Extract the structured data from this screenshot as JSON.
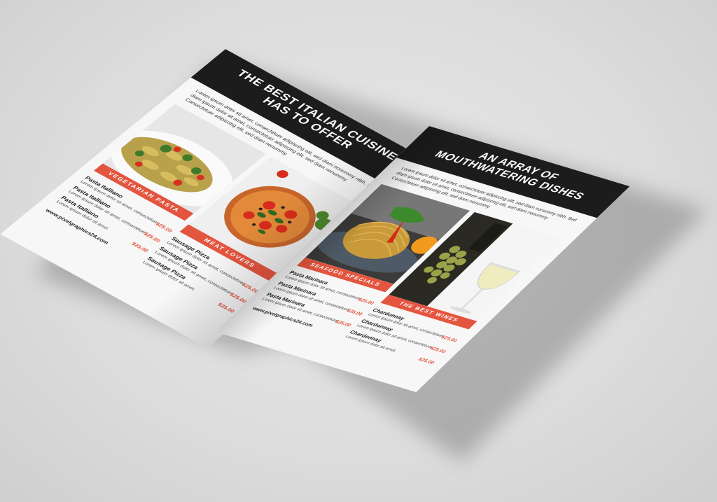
{
  "colors": {
    "accent": "#e4553f",
    "band": "#1c1c1c",
    "paper": "#f7f7f7",
    "background": "#dcdcdc"
  },
  "left_page": {
    "title_line1": "THE BEST ITALIAN CUISINE",
    "title_line2": "HAS TO OFFER",
    "intro": "Lorem ipsum dolor sit amet, consectetuer adipiscing elit, sed diam nonummy nibh. Sed diam ipsum dolor sit amet, consectetuer adipiscing elit, sed diam nonummy. Consectetuer adipiscing elit, sed diam nonummy.",
    "sections": [
      {
        "tag": "VEGETARIAN PASTA",
        "photo": "farfalle-pasta-salad",
        "items": [
          {
            "name": "Pasta Italliano",
            "desc": "Lorem ipsum dolor sit amet, consectetuer.",
            "price": "$25.00"
          },
          {
            "name": "Pasta Italliano",
            "desc": "Lorem ipsum dolor sit amet, consectetuer.",
            "price": "$25.00"
          },
          {
            "name": "Pasta Italliano",
            "desc": "Lorem ipsum dolor sit amet.",
            "price": "$25.00"
          }
        ]
      },
      {
        "tag": "MEAT LOVERS",
        "photo": "pizza",
        "items": [
          {
            "name": "Sausage Pizza",
            "desc": "Lorem ipsum dolor sit amet, consectetuer.",
            "price": "$25.00"
          },
          {
            "name": "Sausage Pizza",
            "desc": "Lorem ipsum dolor sit amet, consectetuer.",
            "price": "$25.00"
          },
          {
            "name": "Sausage Pizza",
            "desc": "Lorem ipsum dolor sit amet.",
            "price": "$25.00"
          }
        ]
      }
    ],
    "footer": "www.pixelgraphics24.com"
  },
  "right_page": {
    "title_line1": "AN ARRAY OF",
    "title_line2": "MOUTHWATERING DISHES",
    "intro": "Lorem ipsum dolor sit amet, consectetuer adipiscing elit, sed diam nonummy nibh. Sed diam ipsum dolor sit amet, consectetuer adipiscing elit, sed diam nonummy. Consectetuer adipiscing elit, sed diam nonummy.",
    "sections": [
      {
        "tag": "SEAFOOD SPECIALS",
        "photo": "spaghetti-with-peppers",
        "items": [
          {
            "name": "Pasta Marinara",
            "desc": "Lorem ipsum dolor sit amet, consectetuer.",
            "price": "$25.00"
          },
          {
            "name": "Pasta Marinara",
            "desc": "Lorem ipsum dolor sit amet, consectetuer.",
            "price": "$25.00"
          },
          {
            "name": "Pasta Marinara",
            "desc": "Lorem ipsum dolor sit amet, consectetuer.",
            "price": "$25.00"
          }
        ]
      },
      {
        "tag": "THE BEST WINES",
        "photo": "wine-bottle-grapes-glass",
        "items": [
          {
            "name": "Chardonnay",
            "desc": "Lorem ipsum dolor sit amet, consectetuer.",
            "price": "$25.00"
          },
          {
            "name": "Chardonnay",
            "desc": "Lorem ipsum dolor sit amet, consectetuer.",
            "price": "$25.00"
          },
          {
            "name": "Chardonnay",
            "desc": "Lorem ipsum dolor sit amet.",
            "price": "$25.00"
          }
        ]
      }
    ],
    "footer": "www.pixelgraphics24.com"
  }
}
